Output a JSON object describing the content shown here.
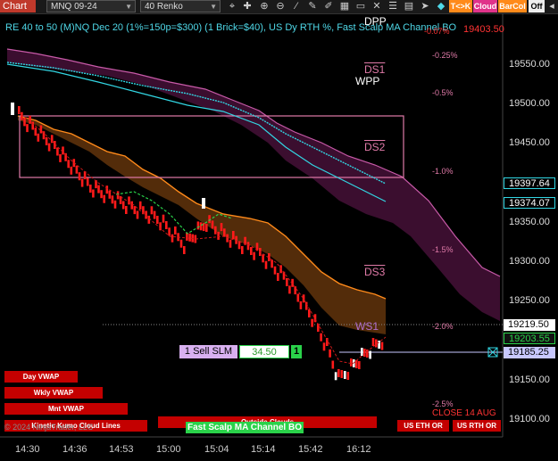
{
  "toolbar": {
    "chart_tab": "Chart",
    "symbol": "MNQ 09-24",
    "interval": "40 Renko",
    "icons": [
      "cursor-icon",
      "crosshair-icon",
      "zoom-in-icon",
      "zoom-out-icon",
      "draw-icon",
      "pen-icon",
      "pencil-icon",
      "grid-icon",
      "box-icon",
      "cross-icon",
      "sliders-icon",
      "calendar-icon",
      "arrow-icon"
    ],
    "toggles": [
      "T<>K",
      "Cloud",
      "BarCol",
      "Off"
    ]
  },
  "title": "RE 40 to 50 (M)NQ Dec 20 (1%=150p=$300) (1 Brick=$40), US Dy RTH %, Fast Scalp MA Channel BO",
  "price_axis": [
    "19550.00",
    "19500.00",
    "19450.00",
    "19400.00",
    "19350.00",
    "19300.00",
    "19250.00",
    "19200.00",
    "19150.00",
    "19100.00"
  ],
  "price_tags": {
    "top": "19403.50",
    "p1": "19397.64",
    "p2": "19374.07",
    "p3": "19219.50",
    "p4": "19203.55",
    "p5": "19185.25"
  },
  "time_axis": [
    "14:30",
    "14:36",
    "14:53",
    "15:00",
    "15:04",
    "15:14",
    "15:42",
    "16:12"
  ],
  "levels": {
    "dpp": "DPP",
    "ds1": "DS1",
    "wpp": "WPP",
    "ds2": "DS2",
    "ds3": "DS3",
    "ws1": "WS1",
    "close": "CLOSE 14 AUG"
  },
  "percent_labels": [
    "-0.25%",
    "-0.5%",
    "-1.0%",
    "-1.5%",
    "-2.0%",
    "-2.5%"
  ],
  "top_pct": "-0.07%",
  "order": {
    "label": "1 Sell SLM",
    "price": "34.50",
    "qty": "1"
  },
  "buttons": {
    "day_vwap": "Day VWAP",
    "wkly_vwap": "Wkly VWAP",
    "mnt_vwap": "Mnt VWAP",
    "outside_clouds": "Outside Clouds",
    "fast_scalp": "Fast Scalp MA Channel BO",
    "kumo": "Kinetic Kumo Cloud Lines",
    "us_eth": "US ETH OR",
    "us_rth": "US RTH OR"
  },
  "copyright": "© 2024 NinjaTrader, LLC",
  "colors": {
    "bull": "#ff1a1a",
    "pink": "#e07aa8",
    "cyan": "#32d6e3",
    "orange": "#ff8a1a",
    "green": "#2ad24a"
  }
}
